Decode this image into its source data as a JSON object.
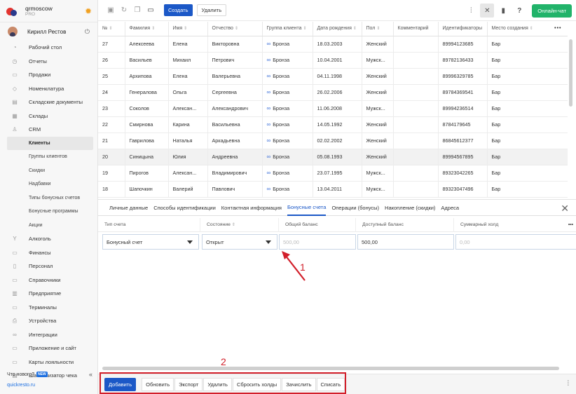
{
  "brand": {
    "name": "qrmoscow",
    "plan": "PRO"
  },
  "user": {
    "name": "Кирилл Рестов"
  },
  "nav": [
    {
      "label": "Рабочий стол",
      "icon": "dashboard-icon",
      "glyph": "◔"
    },
    {
      "label": "Отчеты",
      "icon": "reports-icon",
      "glyph": "◷"
    },
    {
      "label": "Продажи",
      "icon": "sales-icon",
      "glyph": "▭"
    },
    {
      "label": "Номенклатура",
      "icon": "tag-icon",
      "glyph": "◇"
    },
    {
      "label": "Складские документы",
      "icon": "documents-icon",
      "glyph": "▤"
    },
    {
      "label": "Склады",
      "icon": "warehouse-icon",
      "glyph": "▦"
    },
    {
      "label": "CRM",
      "icon": "crm-icon",
      "glyph": "♙"
    }
  ],
  "crm_sub": [
    "Клиенты",
    "Группы клиентов",
    "Скидки",
    "Надбавки",
    "Типы бонусных счетов",
    "Бонусные программы",
    "Акции"
  ],
  "nav2": [
    {
      "label": "Алкоголь",
      "icon": "alcohol-icon",
      "glyph": "Y"
    },
    {
      "label": "Финансы",
      "icon": "finance-icon",
      "glyph": "▭"
    },
    {
      "label": "Персонал",
      "icon": "staff-icon",
      "glyph": "▯"
    },
    {
      "label": "Справочники",
      "icon": "reference-icon",
      "glyph": "▭"
    },
    {
      "label": "Предприятие",
      "icon": "enterprise-icon",
      "glyph": "▥"
    },
    {
      "label": "Терминалы",
      "icon": "terminal-icon",
      "glyph": "▭"
    },
    {
      "label": "Устройства",
      "icon": "devices-icon",
      "glyph": "⎙"
    },
    {
      "label": "Интеграции",
      "icon": "integrations-icon",
      "glyph": "∞"
    },
    {
      "label": "Приложение и сайт",
      "icon": "app-icon",
      "glyph": "▭"
    },
    {
      "label": "Карты лояльности",
      "icon": "loyalty-card-icon",
      "glyph": "▭"
    },
    {
      "label": "Шаблонизатор чека",
      "icon": "receipt-icon",
      "glyph": "▤"
    }
  ],
  "whatsnew": {
    "label": "Что нового?",
    "badge": "NEW"
  },
  "site": "quickresto.ru",
  "toolbar": {
    "create": "Создать",
    "delete": "Удалить",
    "chat": "Онлайн-чат"
  },
  "table": {
    "columns": [
      "№",
      "Фамилия",
      "Имя",
      "Отчество",
      "Группа клиента",
      "Дата рождения",
      "Пол",
      "Комментарий",
      "Идентификаторы",
      "Место создания"
    ],
    "rows": [
      [
        "27",
        "Алексеева",
        "Елена",
        "Викторовна",
        "Бронза",
        "18.03.2003",
        "Женский",
        "",
        "89994123685",
        "Бар"
      ],
      [
        "26",
        "Васильев",
        "Михаил",
        "Петрович",
        "Бронза",
        "10.04.2001",
        "Мужск...",
        "",
        "89782136433",
        "Бар"
      ],
      [
        "25",
        "Архипова",
        "Елена",
        "Валерьевна",
        "Бронза",
        "04.11.1998",
        "Женский",
        "",
        "89996329785",
        "Бар"
      ],
      [
        "24",
        "Генералова",
        "Ольга",
        "Сергеевна",
        "Бронза",
        "26.02.2006",
        "Женский",
        "",
        "89784369541",
        "Бар"
      ],
      [
        "23",
        "Соколов",
        "Алексан...",
        "Александрович",
        "Бронза",
        "11.06.2008",
        "Мужск...",
        "",
        "89994236514",
        "Бар"
      ],
      [
        "22",
        "Смирнова",
        "Карина",
        "Васильевна",
        "Бронза",
        "14.05.1992",
        "Женский",
        "",
        "8784179645",
        "Бар"
      ],
      [
        "21",
        "Гаврилова",
        "Наталья",
        "Аркадьевна",
        "Бронза",
        "02.02.2002",
        "Женский",
        "",
        "86845612377",
        "Бар"
      ],
      [
        "20",
        "Синицына",
        "Юлия",
        "Андреевна",
        "Бронза",
        "05.08.1993",
        "Женский",
        "",
        "89994567895",
        "Бар"
      ],
      [
        "19",
        "Пирогов",
        "Алексан...",
        "Владимирович",
        "Бронза",
        "23.07.1995",
        "Мужск...",
        "",
        "89323042265",
        "Бар"
      ],
      [
        "18",
        "Шапочкин",
        "Валерий",
        "Павлович",
        "Бронза",
        "13.04.2011",
        "Мужск...",
        "",
        "89323047496",
        "Бар"
      ]
    ]
  },
  "tabs": [
    "Личные данные",
    "Способы идентификации",
    "Контактная информация",
    "Бонусные счета",
    "Операции (бонусы)",
    "Накопление (скидки)",
    "Адреса"
  ],
  "bonus": {
    "columns": [
      "Тип счета",
      "Состояние",
      "Общий баланс",
      "Доступный баланс",
      "Суммарный холд"
    ],
    "row": {
      "type": "Бонусный счет",
      "state": "Открыт",
      "total": "500,00",
      "available": "500,00",
      "hold": "0,00"
    }
  },
  "annotations": {
    "one": "1",
    "two": "2"
  },
  "bottom": {
    "add": "Добавить",
    "buttons": [
      "Обновить",
      "Экспорт",
      "Удалить",
      "Сбросить холды",
      "Зачислить",
      "Списать"
    ]
  }
}
